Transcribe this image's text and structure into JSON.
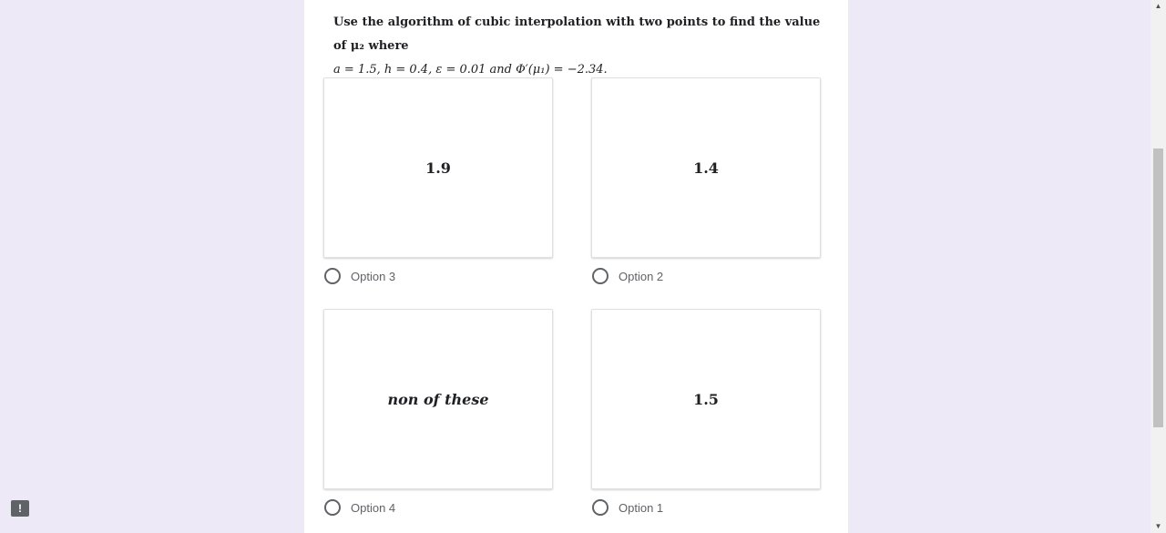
{
  "question": {
    "line1": "Use the algorithm of cubic interpolation with two points to find the value of μ₂ where",
    "line2_prefix": "a = ",
    "line2": "1.5, h = 0.4, ε = 0.01 and Φ′(μ₁) = −2.34."
  },
  "options": [
    {
      "image_text": "1.9",
      "label": "Option 3"
    },
    {
      "image_text": "1.4",
      "label": "Option 2"
    },
    {
      "image_text": "non of these",
      "label": "Option 4"
    },
    {
      "image_text": "1.5",
      "label": "Option 1"
    }
  ],
  "icons": {
    "report": "exclamation-icon",
    "scroll_up": "triangle-up-icon",
    "scroll_down": "triangle-down-icon"
  },
  "report_glyph": "!",
  "scroll_up_glyph": "▲",
  "scroll_down_glyph": "▼"
}
